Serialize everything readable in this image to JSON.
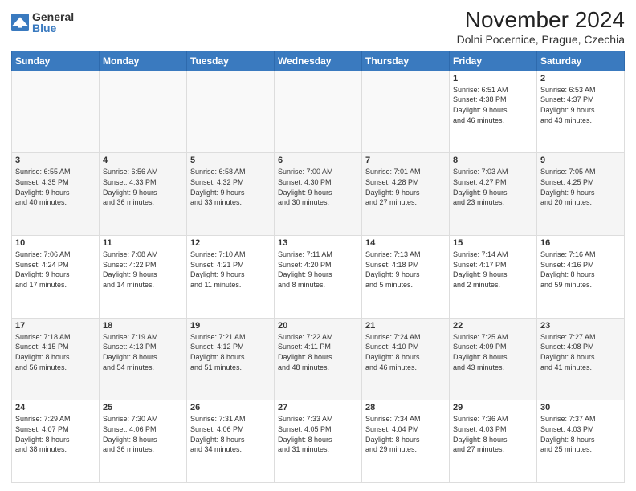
{
  "logo": {
    "general": "General",
    "blue": "Blue"
  },
  "header": {
    "month": "November 2024",
    "location": "Dolni Pocernice, Prague, Czechia"
  },
  "weekdays": [
    "Sunday",
    "Monday",
    "Tuesday",
    "Wednesday",
    "Thursday",
    "Friday",
    "Saturday"
  ],
  "weeks": [
    [
      {
        "day": "",
        "info": ""
      },
      {
        "day": "",
        "info": ""
      },
      {
        "day": "",
        "info": ""
      },
      {
        "day": "",
        "info": ""
      },
      {
        "day": "",
        "info": ""
      },
      {
        "day": "1",
        "info": "Sunrise: 6:51 AM\nSunset: 4:38 PM\nDaylight: 9 hours\nand 46 minutes."
      },
      {
        "day": "2",
        "info": "Sunrise: 6:53 AM\nSunset: 4:37 PM\nDaylight: 9 hours\nand 43 minutes."
      }
    ],
    [
      {
        "day": "3",
        "info": "Sunrise: 6:55 AM\nSunset: 4:35 PM\nDaylight: 9 hours\nand 40 minutes."
      },
      {
        "day": "4",
        "info": "Sunrise: 6:56 AM\nSunset: 4:33 PM\nDaylight: 9 hours\nand 36 minutes."
      },
      {
        "day": "5",
        "info": "Sunrise: 6:58 AM\nSunset: 4:32 PM\nDaylight: 9 hours\nand 33 minutes."
      },
      {
        "day": "6",
        "info": "Sunrise: 7:00 AM\nSunset: 4:30 PM\nDaylight: 9 hours\nand 30 minutes."
      },
      {
        "day": "7",
        "info": "Sunrise: 7:01 AM\nSunset: 4:28 PM\nDaylight: 9 hours\nand 27 minutes."
      },
      {
        "day": "8",
        "info": "Sunrise: 7:03 AM\nSunset: 4:27 PM\nDaylight: 9 hours\nand 23 minutes."
      },
      {
        "day": "9",
        "info": "Sunrise: 7:05 AM\nSunset: 4:25 PM\nDaylight: 9 hours\nand 20 minutes."
      }
    ],
    [
      {
        "day": "10",
        "info": "Sunrise: 7:06 AM\nSunset: 4:24 PM\nDaylight: 9 hours\nand 17 minutes."
      },
      {
        "day": "11",
        "info": "Sunrise: 7:08 AM\nSunset: 4:22 PM\nDaylight: 9 hours\nand 14 minutes."
      },
      {
        "day": "12",
        "info": "Sunrise: 7:10 AM\nSunset: 4:21 PM\nDaylight: 9 hours\nand 11 minutes."
      },
      {
        "day": "13",
        "info": "Sunrise: 7:11 AM\nSunset: 4:20 PM\nDaylight: 9 hours\nand 8 minutes."
      },
      {
        "day": "14",
        "info": "Sunrise: 7:13 AM\nSunset: 4:18 PM\nDaylight: 9 hours\nand 5 minutes."
      },
      {
        "day": "15",
        "info": "Sunrise: 7:14 AM\nSunset: 4:17 PM\nDaylight: 9 hours\nand 2 minutes."
      },
      {
        "day": "16",
        "info": "Sunrise: 7:16 AM\nSunset: 4:16 PM\nDaylight: 8 hours\nand 59 minutes."
      }
    ],
    [
      {
        "day": "17",
        "info": "Sunrise: 7:18 AM\nSunset: 4:15 PM\nDaylight: 8 hours\nand 56 minutes."
      },
      {
        "day": "18",
        "info": "Sunrise: 7:19 AM\nSunset: 4:13 PM\nDaylight: 8 hours\nand 54 minutes."
      },
      {
        "day": "19",
        "info": "Sunrise: 7:21 AM\nSunset: 4:12 PM\nDaylight: 8 hours\nand 51 minutes."
      },
      {
        "day": "20",
        "info": "Sunrise: 7:22 AM\nSunset: 4:11 PM\nDaylight: 8 hours\nand 48 minutes."
      },
      {
        "day": "21",
        "info": "Sunrise: 7:24 AM\nSunset: 4:10 PM\nDaylight: 8 hours\nand 46 minutes."
      },
      {
        "day": "22",
        "info": "Sunrise: 7:25 AM\nSunset: 4:09 PM\nDaylight: 8 hours\nand 43 minutes."
      },
      {
        "day": "23",
        "info": "Sunrise: 7:27 AM\nSunset: 4:08 PM\nDaylight: 8 hours\nand 41 minutes."
      }
    ],
    [
      {
        "day": "24",
        "info": "Sunrise: 7:29 AM\nSunset: 4:07 PM\nDaylight: 8 hours\nand 38 minutes."
      },
      {
        "day": "25",
        "info": "Sunrise: 7:30 AM\nSunset: 4:06 PM\nDaylight: 8 hours\nand 36 minutes."
      },
      {
        "day": "26",
        "info": "Sunrise: 7:31 AM\nSunset: 4:06 PM\nDaylight: 8 hours\nand 34 minutes."
      },
      {
        "day": "27",
        "info": "Sunrise: 7:33 AM\nSunset: 4:05 PM\nDaylight: 8 hours\nand 31 minutes."
      },
      {
        "day": "28",
        "info": "Sunrise: 7:34 AM\nSunset: 4:04 PM\nDaylight: 8 hours\nand 29 minutes."
      },
      {
        "day": "29",
        "info": "Sunrise: 7:36 AM\nSunset: 4:03 PM\nDaylight: 8 hours\nand 27 minutes."
      },
      {
        "day": "30",
        "info": "Sunrise: 7:37 AM\nSunset: 4:03 PM\nDaylight: 8 hours\nand 25 minutes."
      }
    ]
  ]
}
